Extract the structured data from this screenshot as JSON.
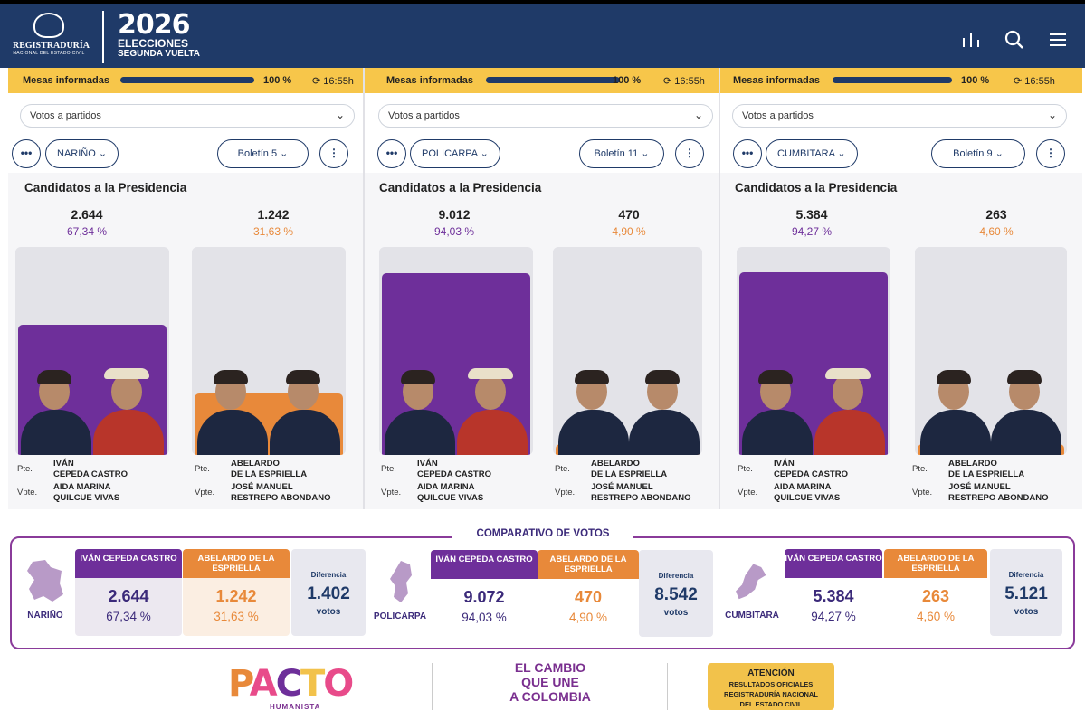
{
  "header": {
    "registry_line1": "REGISTRADURÍA",
    "registry_line2": "NACIONAL DEL ESTADO CIVIL",
    "election_year": "2026",
    "election_title": "ELECCIONES",
    "election_round": "SEGUNDA VUELTA",
    "icons": [
      "chart-icon",
      "search-icon",
      "menu-icon"
    ]
  },
  "panels": [
    {
      "status_label": "Mesas informadas",
      "status_progress": 100,
      "status_pct": "100 %",
      "status_time": "16:55h",
      "select_value": "Votos a partidos",
      "location": "NARIÑO",
      "bulletin": "Boletín 5",
      "section_title": "Candidatos a la Presidencia",
      "candidates": [
        {
          "votes": "2.644",
          "pct": "67,34 %",
          "share": 67.34,
          "color": "#6e2f9a",
          "pte_role": "Pte.",
          "pte_name1": "IVÁN",
          "pte_name2": "CEPEDA CASTRO",
          "vpte_role": "Vpte.",
          "vpte_name1": "AIDA MARINA",
          "vpte_name2": "QUILCUE VIVAS"
        },
        {
          "votes": "1.242",
          "pct": "31,63 %",
          "share": 31.63,
          "color": "#e8893a",
          "pte_role": "Pte.",
          "pte_name1": "ABELARDO",
          "pte_name2": "DE LA ESPRIELLA",
          "vpte_role": "Vpte.",
          "vpte_name1": "JOSÉ MANUEL",
          "vpte_name2": "RESTREPO ABONDANO"
        }
      ]
    },
    {
      "status_label": "Mesas informadas",
      "status_progress": 100,
      "status_pct": "100 %",
      "status_time": "16:55h",
      "select_value": "Votos a partidos",
      "location": "POLICARPA",
      "bulletin": "Boletín 11",
      "section_title": "Candidatos a la Presidencia",
      "candidates": [
        {
          "votes": "9.012",
          "pct": "94,03 %",
          "share": 94.03,
          "color": "#6e2f9a",
          "pte_role": "Pte.",
          "pte_name1": "IVÁN",
          "pte_name2": "CEPEDA CASTRO",
          "vpte_role": "Vpte.",
          "vpte_name1": "AIDA MARINA",
          "vpte_name2": "QUILCUE VIVAS"
        },
        {
          "votes": "470",
          "pct": "4,90 %",
          "share": 4.9,
          "color": "#e8893a",
          "pte_role": "Pte.",
          "pte_name1": "ABELARDO",
          "pte_name2": "DE LA ESPRIELLA",
          "vpte_role": "Vpte.",
          "vpte_name1": "JOSÉ MANUEL",
          "vpte_name2": "RESTREPO ABONDANO"
        }
      ]
    },
    {
      "status_label": "Mesas informadas",
      "status_progress": 100,
      "status_pct": "100 %",
      "status_time": "16:55h",
      "select_value": "Votos a partidos",
      "location": "CUMBITARA",
      "bulletin": "Boletín 9",
      "section_title": "Candidatos a la Presidencia",
      "candidates": [
        {
          "votes": "5.384",
          "pct": "94,27 %",
          "share": 94.27,
          "color": "#6e2f9a",
          "pte_role": "Pte.",
          "pte_name1": "IVÁN",
          "pte_name2": "CEPEDA CASTRO",
          "vpte_role": "Vpte.",
          "vpte_name1": "AIDA MARINA",
          "vpte_name2": "QUILCUE VIVAS"
        },
        {
          "votes": "263",
          "pct": "4,60 %",
          "share": 4.6,
          "color": "#e8893a",
          "pte_role": "Pte.",
          "pte_name1": "ABELARDO",
          "pte_name2": "DE LA ESPRIELLA",
          "vpte_role": "Vpte.",
          "vpte_name1": "JOSÉ MANUEL",
          "vpte_name2": "RESTREPO ABONDANO"
        }
      ]
    }
  ],
  "comparison": {
    "title": "COMPARATIVO DE VOTOS",
    "blocks": [
      {
        "place": "NARIÑO",
        "c1_header": "IVÁN CEPEDA CASTRO",
        "c1_votes": "2.644",
        "c1_pct": "67,34 %",
        "c2_header": "ABELARDO DE LA ESPRIELLA",
        "c2_votes": "1.242",
        "c2_pct": "31,63 %",
        "diff_label": "Diferencia",
        "diff_value": "1.402",
        "diff_unit": "votos"
      },
      {
        "place": "POLICARPA",
        "c1_header": "IVÁN CEPEDA CASTRO",
        "c1_votes": "9.072",
        "c1_pct": "94,03 %",
        "c2_header": "ABELARDO DE LA ESPRIELLA",
        "c2_votes": "470",
        "c2_pct": "4,90 %",
        "diff_label": "Diferencia",
        "diff_value": "8.542",
        "diff_unit": "votos"
      },
      {
        "place": "CUMBITARA",
        "c1_header": "IVÁN CEPEDA CASTRO",
        "c1_votes": "5.384",
        "c1_pct": "94,27 %",
        "c2_header": "ABELARDO DE LA ESPRIELLA",
        "c2_votes": "263",
        "c2_pct": "4,60 %",
        "diff_label": "Diferencia",
        "diff_value": "5.121",
        "diff_unit": "votos"
      }
    ]
  },
  "footer": {
    "pacto_logo": "PACTO",
    "pacto_sub": "HUMANISTA",
    "slogan_1": "EL CAMBIO",
    "slogan_2": "QUE UNE",
    "slogan_3": "A COLOMBIA",
    "att_title": "ATENCIÓN",
    "att_line1": "RESULTADOS OFICIALES",
    "att_line2": "REGISTRADURÍA NACIONAL",
    "att_line3": "DEL ESTADO CIVIL"
  },
  "colors": {
    "navy": "#1f3a68",
    "yellow": "#f7c64a",
    "purple": "#6e2f9a",
    "orange": "#e8893a"
  }
}
